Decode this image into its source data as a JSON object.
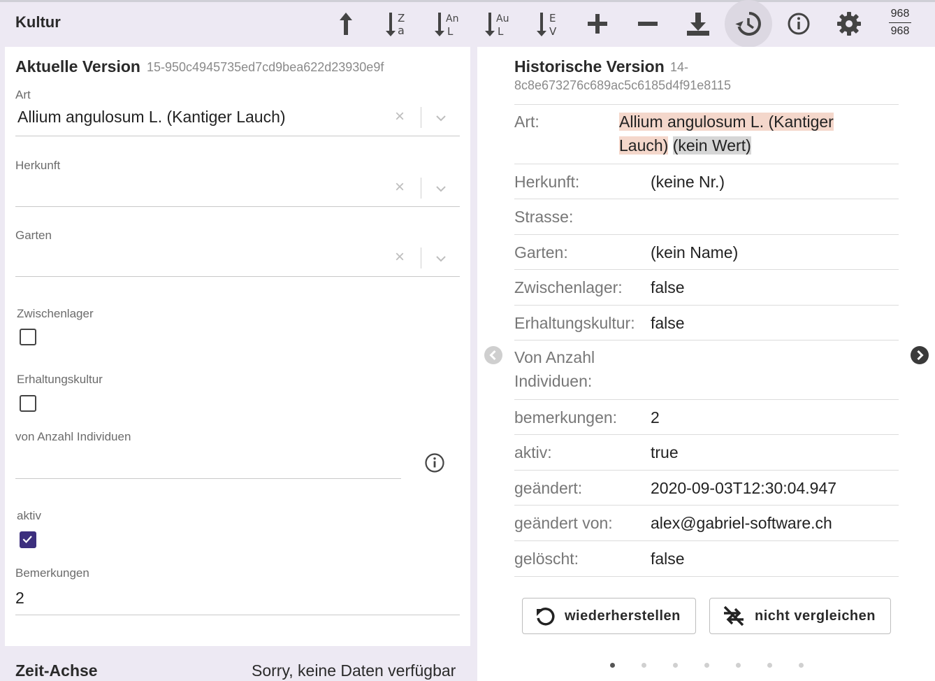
{
  "toolbar": {
    "title": "Kultur",
    "icons": [
      "arrow-up-icon",
      "sort-alpha-icon",
      "sort-art-name-icon",
      "sort-art-author-icon",
      "sort-ev-icon",
      "plus-icon",
      "minus-icon",
      "download-icon",
      "history-icon",
      "info-icon",
      "settings-icon"
    ],
    "count_top": "968",
    "count_bottom": "968"
  },
  "current": {
    "title": "Aktuelle Version",
    "id": "15-950c4945735ed7cd9bea622d23930e9f",
    "art": {
      "label": "Art",
      "value": "Allium angulosum L. (Kantiger Lauch)"
    },
    "herkunft": {
      "label": "Herkunft",
      "value": ""
    },
    "garten": {
      "label": "Garten",
      "value": ""
    },
    "zwischenlager": {
      "label": "Zwischenlager",
      "checked": false
    },
    "erhaltungskultur": {
      "label": "Erhaltungskultur",
      "checked": false
    },
    "von_anzahl": {
      "label": "von Anzahl Individuen",
      "value": ""
    },
    "aktiv": {
      "label": "aktiv",
      "checked": true
    },
    "bemerkungen": {
      "label": "Bemerkungen",
      "value": "2"
    }
  },
  "zeit_achse": {
    "title": "Zeit-Achse",
    "message": "Sorry, keine Daten verfügbar"
  },
  "history": {
    "title": "Historische Version",
    "id_line1": "14-",
    "id_line2": "8c8e673276c689ac5c6185d4f91e8115",
    "rows": [
      {
        "label": "Art:",
        "new_value_line1": "Allium angulosum L. (Kantiger",
        "new_value_line2": "Lauch)",
        "old_value": "(kein Wert)"
      },
      {
        "label": "Herkunft:",
        "value": "(keine Nr.)"
      },
      {
        "label": "Strasse:",
        "value": ""
      },
      {
        "label": "Garten:",
        "value": "(kein Name)"
      },
      {
        "label": "Zwischenlager:",
        "value": "false"
      },
      {
        "label": "Erhaltungskultur:",
        "value": "false"
      },
      {
        "label_line1": "Von Anzahl",
        "label_line2": "Individuen:",
        "value": ""
      },
      {
        "label": "bemerkungen:",
        "value": "2"
      },
      {
        "label": "aktiv:",
        "value": "true"
      },
      {
        "label": "geändert:",
        "value": "2020-09-03T12:30:04.947"
      },
      {
        "label": "geändert von:",
        "value": "alex@gabriel-software.ch"
      },
      {
        "label": "gelöscht:",
        "value": "false"
      }
    ],
    "restore_label": "wiederherstellen",
    "no_compare_label": "nicht vergleichen",
    "page_dots": 7,
    "active_dot": 0
  },
  "colors": {
    "accent": "#3c2f7e",
    "toolbar_bg": "#ede9f3",
    "diff_new": "#f4d7cb",
    "diff_old": "#d6d6d6"
  }
}
